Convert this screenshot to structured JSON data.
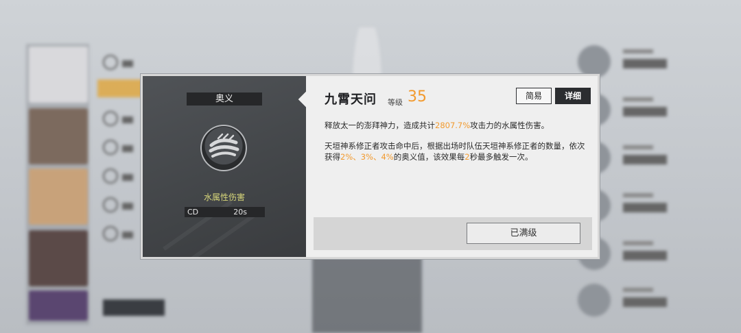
{
  "skill": {
    "type_label": "奥义",
    "name": "九霄天问",
    "level_label": "等级",
    "level": "35",
    "damage_type": "水属性伤害",
    "cd_label": "CD",
    "cd_value": "20s",
    "icon": "water-claw-icon"
  },
  "view_modes": {
    "simple": "简易",
    "detail": "详细",
    "active": "detail"
  },
  "description": {
    "line1": [
      {
        "text": "释放太一的澎拜神力，造成共计",
        "hl": false
      },
      {
        "text": "2807.7%",
        "hl": true
      },
      {
        "text": "攻击力的水属性伤害。",
        "hl": false
      }
    ],
    "line2": [
      {
        "text": "天垣神系修正者攻击命中后，根据出场时队伍天垣神系修正者的数量，依次获得",
        "hl": false
      },
      {
        "text": "2%、3%、4%",
        "hl": true
      },
      {
        "text": "的奥义值，该效果每",
        "hl": false
      },
      {
        "text": "2",
        "hl": true
      },
      {
        "text": "秒最多触发一次。",
        "hl": false
      }
    ]
  },
  "footer": {
    "max_button": "已满级"
  },
  "colors": {
    "accent": "#f29a2e",
    "damage": "#d8d77a",
    "dark": "#2b2d30"
  }
}
